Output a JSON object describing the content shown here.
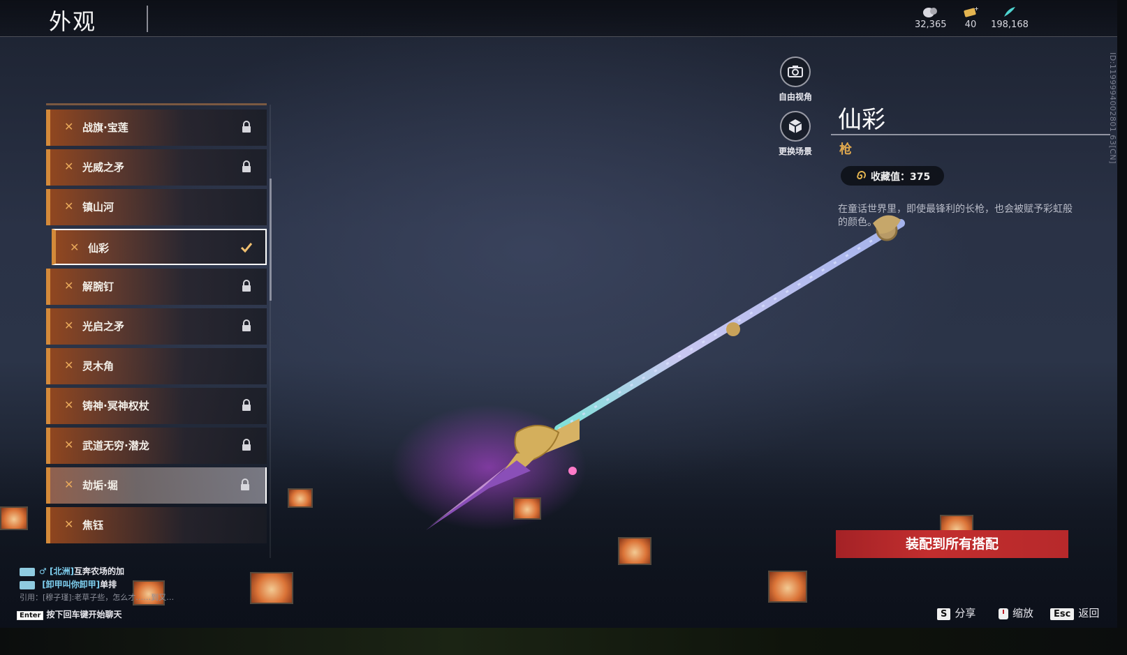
{
  "header": {
    "title": "外观",
    "currencies": [
      {
        "icon": "coin-pouch-icon",
        "value": "32,365"
      },
      {
        "icon": "gold-ticket-icon",
        "value": "40"
      },
      {
        "icon": "jade-feather-icon",
        "value": "198,168"
      }
    ]
  },
  "player_id": "ID:1199994002801 63[CN]",
  "list": {
    "items": [
      {
        "label": "战旗·宝莲",
        "locked": true
      },
      {
        "label": "光威之矛",
        "locked": true
      },
      {
        "label": "镇山河",
        "locked": false
      },
      {
        "label": "仙彩",
        "locked": false,
        "selected": true
      },
      {
        "label": "解腕钉",
        "locked": true
      },
      {
        "label": "光启之矛",
        "locked": true
      },
      {
        "label": "灵木角",
        "locked": false
      },
      {
        "label": "铸神·冥神权杖",
        "locked": true
      },
      {
        "label": "武道无穷·潜龙",
        "locked": true
      },
      {
        "label": "劫垢·堀",
        "locked": true,
        "hover": true
      },
      {
        "label": "焦钰",
        "locked": false
      }
    ]
  },
  "side_buttons": {
    "free_view": "自由视角",
    "change_scene": "更换场景"
  },
  "detail": {
    "name": "仙彩",
    "type": "枪",
    "collect_label": "收藏值：375",
    "description": "在童话世界里，即使最锋利的长枪，也会被赋予彩虹般的颜色。"
  },
  "equip_button": "装配到所有搭配",
  "hints": [
    {
      "key": "S",
      "label": "分享"
    },
    {
      "key": "",
      "label": "缩放"
    },
    {
      "key": "Esc",
      "label": "返回"
    }
  ],
  "chat": {
    "lines": [
      {
        "channel": "[北洲]",
        "text": "互奔农场的加"
      },
      {
        "channel": "[卸甲叫你卸甲]",
        "text": "单排"
      }
    ],
    "quote": "引用：[穆子瑾]:老草子些，怎么才……到又…",
    "enter_key": "Enter",
    "enter_hint": "按下回车键开始聊天"
  },
  "colors": {
    "accent_orange": "#d48a3a",
    "equip_red": "#c22e2e",
    "type_gold": "#e0a84e"
  }
}
